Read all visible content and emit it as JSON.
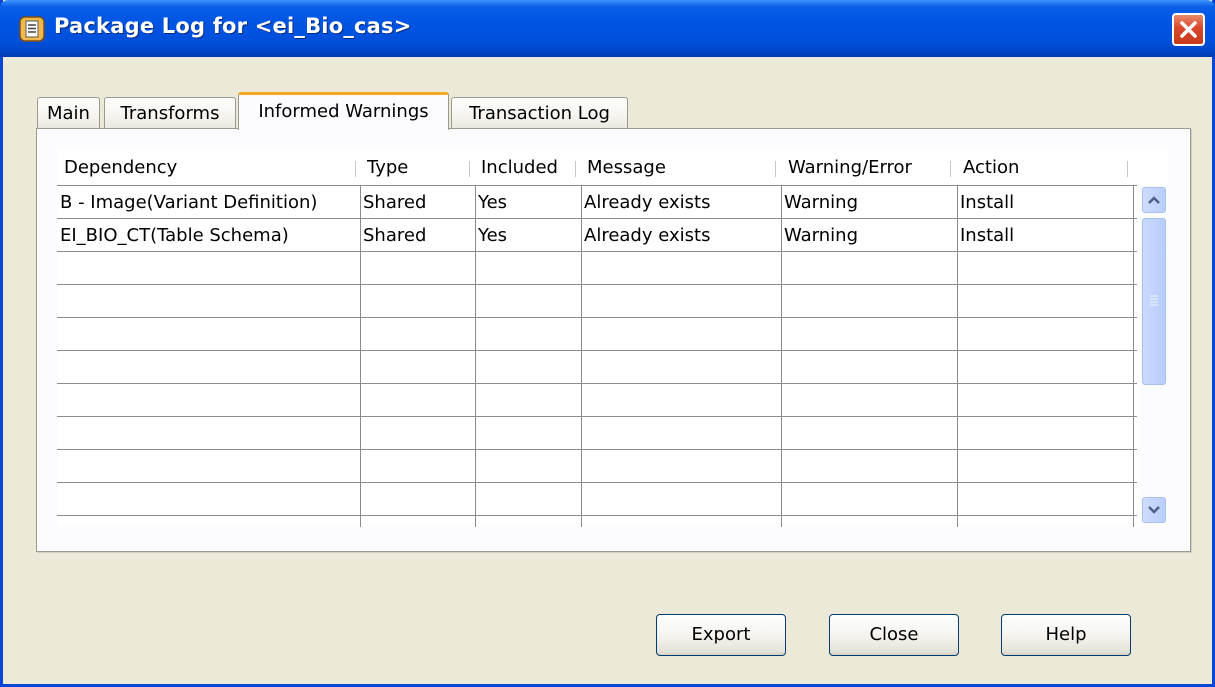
{
  "window": {
    "title": "Package Log for <ei_Bio_cas>"
  },
  "tabs": [
    {
      "label": "Main"
    },
    {
      "label": "Transforms"
    },
    {
      "label": "Informed Warnings"
    },
    {
      "label": "Transaction Log"
    }
  ],
  "active_tab": "Informed Warnings",
  "table": {
    "columns": [
      "Dependency",
      "Type",
      "Included",
      "Message",
      "Warning/Error",
      "Action"
    ],
    "rows": [
      {
        "dependency": "B - Image(Variant Definition)",
        "type": "Shared",
        "included": "Yes",
        "message": "Already exists",
        "warning_error": "Warning",
        "action": "Install"
      },
      {
        "dependency": "EI_BIO_CT(Table Schema)",
        "type": "Shared",
        "included": "Yes",
        "message": "Already exists",
        "warning_error": "Warning",
        "action": "Install"
      }
    ]
  },
  "buttons": {
    "export": "Export",
    "close": "Close",
    "help": "Help"
  },
  "colors": {
    "titlebar": "#0054e3",
    "window_bg": "#ece9d8",
    "active_tab_accent": "#f5a623",
    "close_button": "#d9482a"
  }
}
